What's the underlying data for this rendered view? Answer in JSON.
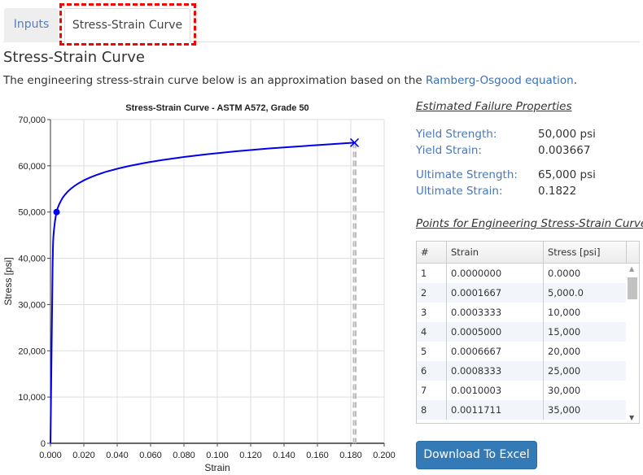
{
  "tabs": [
    {
      "label": "Inputs",
      "active": false
    },
    {
      "label": "Stress-Strain Curve",
      "active": true
    }
  ],
  "highlight_color": "#ff0000",
  "heading": "Stress-Strain Curve",
  "intro": {
    "text": "The engineering stress-strain curve below is an approximation based on the ",
    "link": "Ramberg-Osgood equation",
    "end": "."
  },
  "properties": {
    "title": "Estimated Failure Properties",
    "yield_strength_label": "Yield Strength:",
    "yield_strength": "50,000 psi",
    "yield_strain_label": "Yield Strain:",
    "yield_strain": "0.003667",
    "ultimate_strength_label": "Ultimate Strength:",
    "ultimate_strength": "65,000 psi",
    "ultimate_strain_label": "Ultimate Strain:",
    "ultimate_strain": "0.1822"
  },
  "points_table": {
    "title": "Points for Engineering Stress-Strain Curve",
    "columns": [
      "#",
      "Strain",
      "Stress [psi]"
    ],
    "rows": [
      [
        "1",
        "0.0000000",
        "0.0000"
      ],
      [
        "2",
        "0.0001667",
        "5,000.0"
      ],
      [
        "3",
        "0.0003333",
        "10,000"
      ],
      [
        "4",
        "0.0005000",
        "15,000"
      ],
      [
        "5",
        "0.0006667",
        "20,000"
      ],
      [
        "6",
        "0.0008333",
        "25,000"
      ],
      [
        "7",
        "0.0010003",
        "30,000"
      ],
      [
        "8",
        "0.0011711",
        "35,000"
      ]
    ]
  },
  "download_button": "Download To Excel",
  "chart_data": {
    "type": "line",
    "title": "Stress-Strain Curve - ASTM A572, Grade 50",
    "xlabel": "Strain",
    "ylabel": "Stress [psi]",
    "xlim": [
      0,
      0.2
    ],
    "ylim": [
      0,
      70000
    ],
    "xticks": [
      "0.000",
      "0.020",
      "0.040",
      "0.060",
      "0.080",
      "0.100",
      "0.120",
      "0.140",
      "0.160",
      "0.180",
      "0.200"
    ],
    "yticks": [
      "0",
      "10,000",
      "20,000",
      "30,000",
      "40,000",
      "50,000",
      "60,000",
      "70,000"
    ],
    "grid": true,
    "line_color": "#0000ee",
    "series": [
      {
        "points": [
          [
            0,
            0
          ],
          [
            0.0011711,
            35000
          ],
          [
            0.001377,
            40000
          ],
          [
            0.00183,
            45000
          ],
          [
            0.003667,
            50000
          ],
          [
            0.00637,
            52500
          ],
          [
            0.0087,
            53750
          ],
          [
            0.01209,
            55000
          ],
          [
            0.01696,
            56250
          ],
          [
            0.0239,
            57500
          ],
          [
            0.03374,
            58750
          ],
          [
            0.0476,
            60000
          ],
          [
            0.06698,
            61250
          ],
          [
            0.0939,
            62500
          ],
          [
            0.1311,
            63750
          ],
          [
            0.1822,
            65000
          ]
        ]
      }
    ],
    "yield_point": [
      0.003667,
      50000
    ],
    "ultimate_point": [
      0.1822,
      65000
    ],
    "ultimate_strain_marker": 0.1822
  }
}
